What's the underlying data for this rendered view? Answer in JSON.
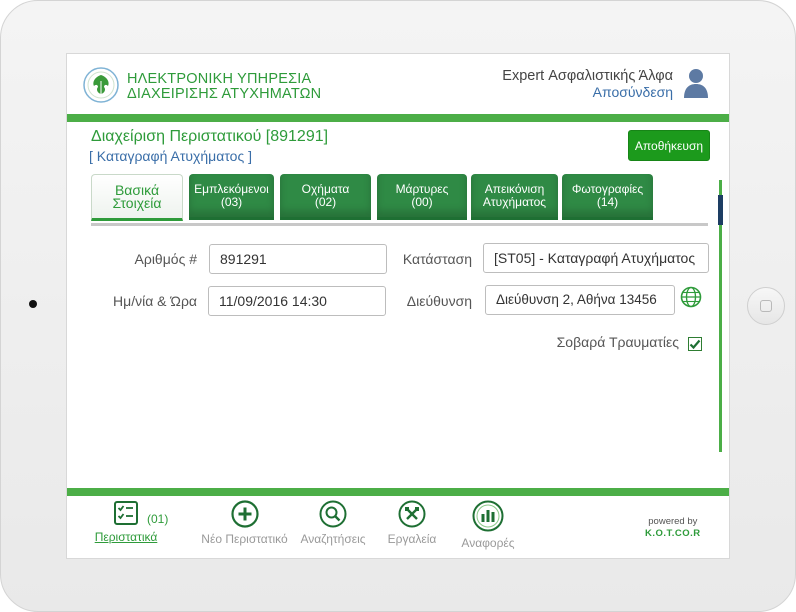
{
  "header": {
    "brand_line1": "ΗΛΕΚΤΡΟΝΙΚΗ ΥΠΗΡΕΣΙΑ",
    "brand_line2": "ΔΙΑΧΕΙΡΙΣΗΣ ΑΤΥΧΗΜΑΤΩΝ",
    "user_name": "Expert Ασφαλιστικής Άλφα",
    "logout": "Αποσύνδεση"
  },
  "page": {
    "title": "Διαχείριση Περιστατικού [891291]",
    "subtitle": "[ Καταγραφή Ατυχήματος ]",
    "save_label": "Αποθήκευση"
  },
  "tabs": [
    {
      "line1": "Βασικά",
      "line2": "Στοιχεία"
    },
    {
      "line1": "Εμπλεκόμενοι",
      "line2": "(03)"
    },
    {
      "line1": "Οχήματα",
      "line2": "(02)"
    },
    {
      "line1": "Μάρτυρες",
      "line2": "(00)"
    },
    {
      "line1": "Απεικόνιση",
      "line2": "Ατυχήματος"
    },
    {
      "line1": "Φωτογραφίες",
      "line2": "(14)"
    }
  ],
  "form": {
    "number_label": "Αριθμός #",
    "number_value": "891291",
    "status_label": "Κατάσταση",
    "status_value": "[ST05] - Καταγραφή Ατυχήματος",
    "datetime_label": "Ημ/νία & Ώρα",
    "datetime_value": "11/09/2016 14:30",
    "address_label": "Διεύθυνση",
    "address_value": "Διεύθυνση 2, Αθήνα 13456",
    "injuries_label": "Σοβαρά Τραυματίες",
    "injuries_checked": true
  },
  "bottom_nav": {
    "incidents_label": "Περιστατικά",
    "incidents_count": "(01)",
    "new_label": "Νέο Περιστατικό",
    "search_label": "Αναζητήσεις",
    "tools_label": "Εργαλεία",
    "reports_label": "Αναφορές"
  },
  "powered": {
    "line1": "powered by",
    "line2": "K.O.T.CO.R"
  },
  "colors": {
    "accent_green": "#4cae47",
    "dark_green": "#2f8a45",
    "link_blue": "#3a6ea8"
  }
}
